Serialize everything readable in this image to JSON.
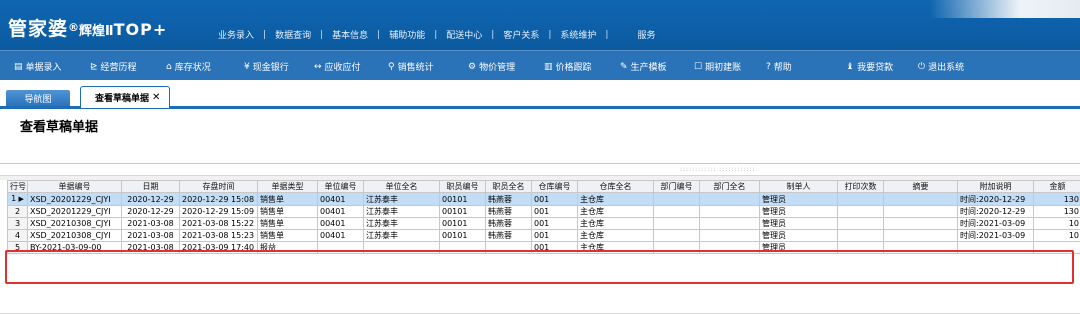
{
  "app": {
    "logo_cn": "管家婆",
    "logo_sup": "®",
    "logo_edition": "辉煌Ⅱ",
    "logo_top": "TOP+"
  },
  "top_menu": [
    "业务录入",
    "数据查询",
    "基本信息",
    "辅助功能",
    "配送中心",
    "客户关系",
    "系统维护",
    "服务"
  ],
  "toolbar": [
    {
      "label": "单据录入",
      "icon": "document-icon",
      "glyph": "▤"
    },
    {
      "label": "经营历程",
      "icon": "chart-icon",
      "glyph": "⊵"
    },
    {
      "label": "库存状况",
      "icon": "warehouse-icon",
      "glyph": "⌂"
    },
    {
      "label": "现金银行",
      "icon": "yuan-icon",
      "glyph": "¥"
    },
    {
      "label": "应收应付",
      "icon": "exchange-icon",
      "glyph": "↔"
    },
    {
      "label": "销售统计",
      "icon": "search-icon",
      "glyph": "⚲"
    },
    {
      "label": "物价管理",
      "icon": "gear-icon",
      "glyph": "⚙"
    },
    {
      "label": "价格跟踪",
      "icon": "bar-chart-icon",
      "glyph": "▥"
    },
    {
      "label": "生产模板",
      "icon": "wrench-icon",
      "glyph": "✎"
    },
    {
      "label": "期初建账",
      "icon": "edit-icon",
      "glyph": "☐"
    },
    {
      "label": "帮助",
      "icon": "help-icon",
      "glyph": "?"
    },
    {
      "label": "我要贷款",
      "icon": "bag-icon",
      "glyph": "♝"
    },
    {
      "label": "退出系统",
      "icon": "power-icon",
      "glyph": "⏻"
    }
  ],
  "tabs": {
    "nav_label": "导航图",
    "active_label": "查看草稿单据",
    "close_glyph": "✕"
  },
  "page_title": "查看草稿单据",
  "grip": "::::::::::::  ::::::::::::",
  "table": {
    "columns": [
      "行号",
      "单据编号",
      "日期",
      "存盘时间",
      "单据类型",
      "单位编号",
      "单位全名",
      "职员编号",
      "职员全名",
      "仓库编号",
      "仓库全名",
      "部门编号",
      "部门全名",
      "制单人",
      "打印次数",
      "摘要",
      "附加说明",
      "金额"
    ],
    "rows": [
      [
        "1",
        "XSD_20201229_CJYI",
        "2020-12-29",
        "2020-12-29 15:08",
        "销售单",
        "00401",
        "江苏泰丰",
        "00101",
        "韩燕蓉",
        "001",
        "主仓库",
        "",
        "",
        "管理员",
        "",
        "",
        "时间:2020-12-29",
        "130"
      ],
      [
        "2",
        "XSD_20201229_CJYI",
        "2020-12-29",
        "2020-12-29 15:09",
        "销售单",
        "00401",
        "江苏泰丰",
        "00101",
        "韩燕蓉",
        "001",
        "主仓库",
        "",
        "",
        "管理员",
        "",
        "",
        "时间:2020-12-29",
        "130"
      ],
      [
        "3",
        "XSD_20210308_CJYI",
        "2021-03-08",
        "2021-03-08 15:22",
        "销售单",
        "00401",
        "江苏泰丰",
        "00101",
        "韩燕蓉",
        "001",
        "主仓库",
        "",
        "",
        "管理员",
        "",
        "",
        "时间:2021-03-09",
        "10"
      ],
      [
        "4",
        "XSD_20210308_CJYI",
        "2021-03-08",
        "2021-03-08 15:23",
        "销售单",
        "00401",
        "江苏泰丰",
        "00101",
        "韩燕蓉",
        "001",
        "主仓库",
        "",
        "",
        "管理员",
        "",
        "",
        "时间:2021-03-09",
        "10"
      ],
      [
        "5",
        "BY-2021-03-09-00",
        "2021-03-08",
        "2021-03-09 17:40",
        "报益",
        "",
        "",
        "",
        "",
        "001",
        "主仓库",
        "",
        "",
        "管理员",
        "",
        "",
        "",
        ""
      ]
    ],
    "selected_row": 0,
    "row_marker": "▶"
  }
}
